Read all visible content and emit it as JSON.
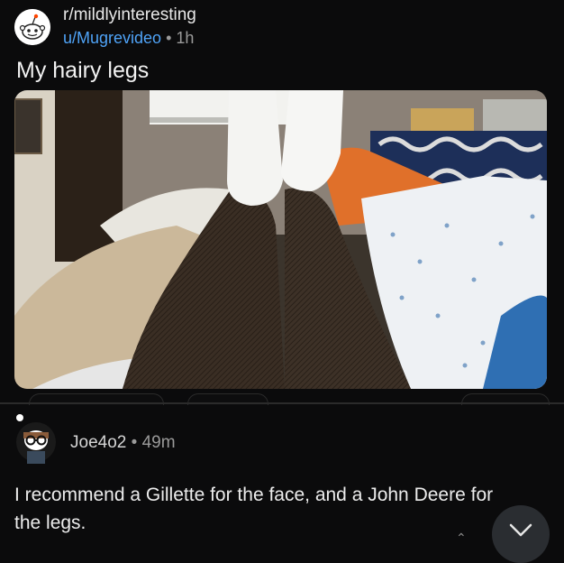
{
  "post": {
    "subreddit": "r/mildlyinteresting",
    "author": "u/Mugrevideo",
    "separator": "•",
    "age": "1h",
    "title": "My hairy legs",
    "image_alt_icon": "photo-of-hairy-legs"
  },
  "comment": {
    "author": "Joe4o2",
    "separator": "•",
    "age": "49m",
    "body": "I recommend a Gillette for the face, and a John Deere for the legs."
  },
  "colors": {
    "background": "#0b0b0c",
    "username_link": "#4fa3f7",
    "muted_text": "#9a9a9a"
  },
  "icons": {
    "subreddit_avatar": "snoo-avatar-icon",
    "comment_avatar": "user-avatar-icon",
    "scroll_button": "chevron-down-icon"
  }
}
